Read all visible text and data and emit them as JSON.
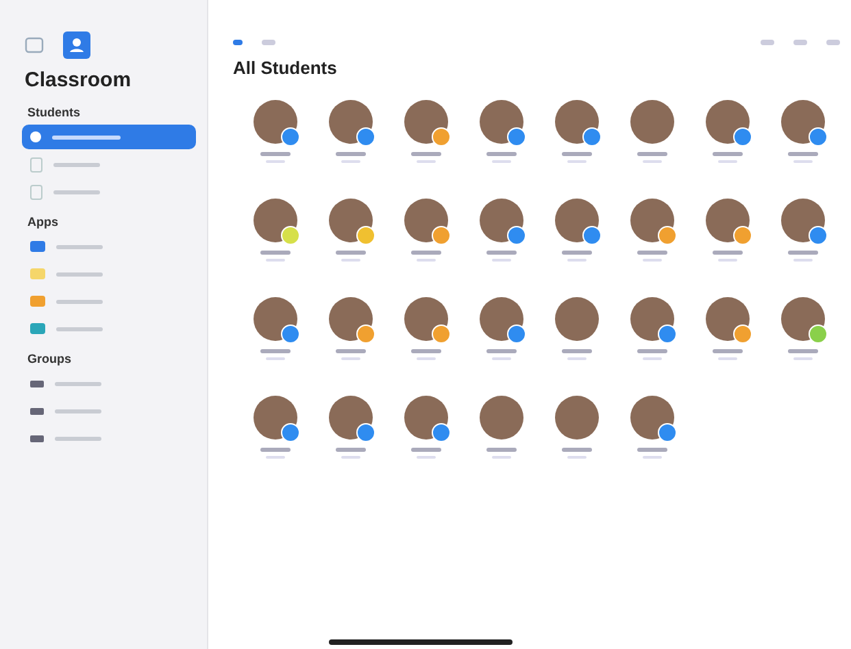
{
  "sidebar": {
    "title": "Classroom",
    "sections": [
      {
        "heading": "Students",
        "items": [
          {
            "kind": "student",
            "selected": true
          },
          {
            "kind": "device",
            "selected": false
          },
          {
            "kind": "device",
            "selected": false
          }
        ]
      },
      {
        "heading": "Apps",
        "items": [
          {
            "kind": "app",
            "selected": false,
            "color": "#2f7be6"
          },
          {
            "kind": "app",
            "selected": false,
            "color": "#f5d66a"
          },
          {
            "kind": "app",
            "selected": false,
            "color": "#f0a030"
          },
          {
            "kind": "app",
            "selected": false,
            "color": "#2aa6b8"
          }
        ]
      },
      {
        "heading": "Groups",
        "items": [
          {
            "kind": "group",
            "selected": false
          },
          {
            "kind": "group",
            "selected": false
          },
          {
            "kind": "group",
            "selected": false
          }
        ]
      }
    ]
  },
  "main": {
    "title": "All Students",
    "students": [
      {
        "badge": true,
        "color": "#2f8cf0"
      },
      {
        "badge": true,
        "color": "#2f8cf0"
      },
      {
        "badge": true,
        "color": "#f0a030"
      },
      {
        "badge": true,
        "color": "#2f8cf0"
      },
      {
        "badge": true,
        "color": "#2f8cf0"
      },
      {
        "badge": false
      },
      {
        "badge": true,
        "color": "#2f8cf0"
      },
      {
        "badge": true,
        "color": "#2f8cf0"
      },
      {
        "badge": true,
        "color": "#d6e04a"
      },
      {
        "badge": true,
        "color": "#f0c030"
      },
      {
        "badge": true,
        "color": "#f0a030"
      },
      {
        "badge": true,
        "color": "#2f8cf0"
      },
      {
        "badge": true,
        "color": "#2f8cf0"
      },
      {
        "badge": true,
        "color": "#f0a030"
      },
      {
        "badge": true,
        "color": "#f0a030"
      },
      {
        "badge": true,
        "color": "#2f8cf0"
      },
      {
        "badge": true,
        "color": "#2f8cf0"
      },
      {
        "badge": true,
        "color": "#f0a030"
      },
      {
        "badge": true,
        "color": "#f0a030"
      },
      {
        "badge": true,
        "color": "#2f8cf0"
      },
      {
        "badge": false
      },
      {
        "badge": true,
        "color": "#2f8cf0"
      },
      {
        "badge": true,
        "color": "#f0a030"
      },
      {
        "badge": true,
        "color": "#8ad04a"
      },
      {
        "badge": true,
        "color": "#2f8cf0"
      },
      {
        "badge": true,
        "color": "#2f8cf0"
      },
      {
        "badge": true,
        "color": "#2f8cf0"
      },
      {
        "badge": false
      },
      {
        "badge": false
      },
      {
        "badge": true,
        "color": "#2f8cf0"
      }
    ]
  }
}
